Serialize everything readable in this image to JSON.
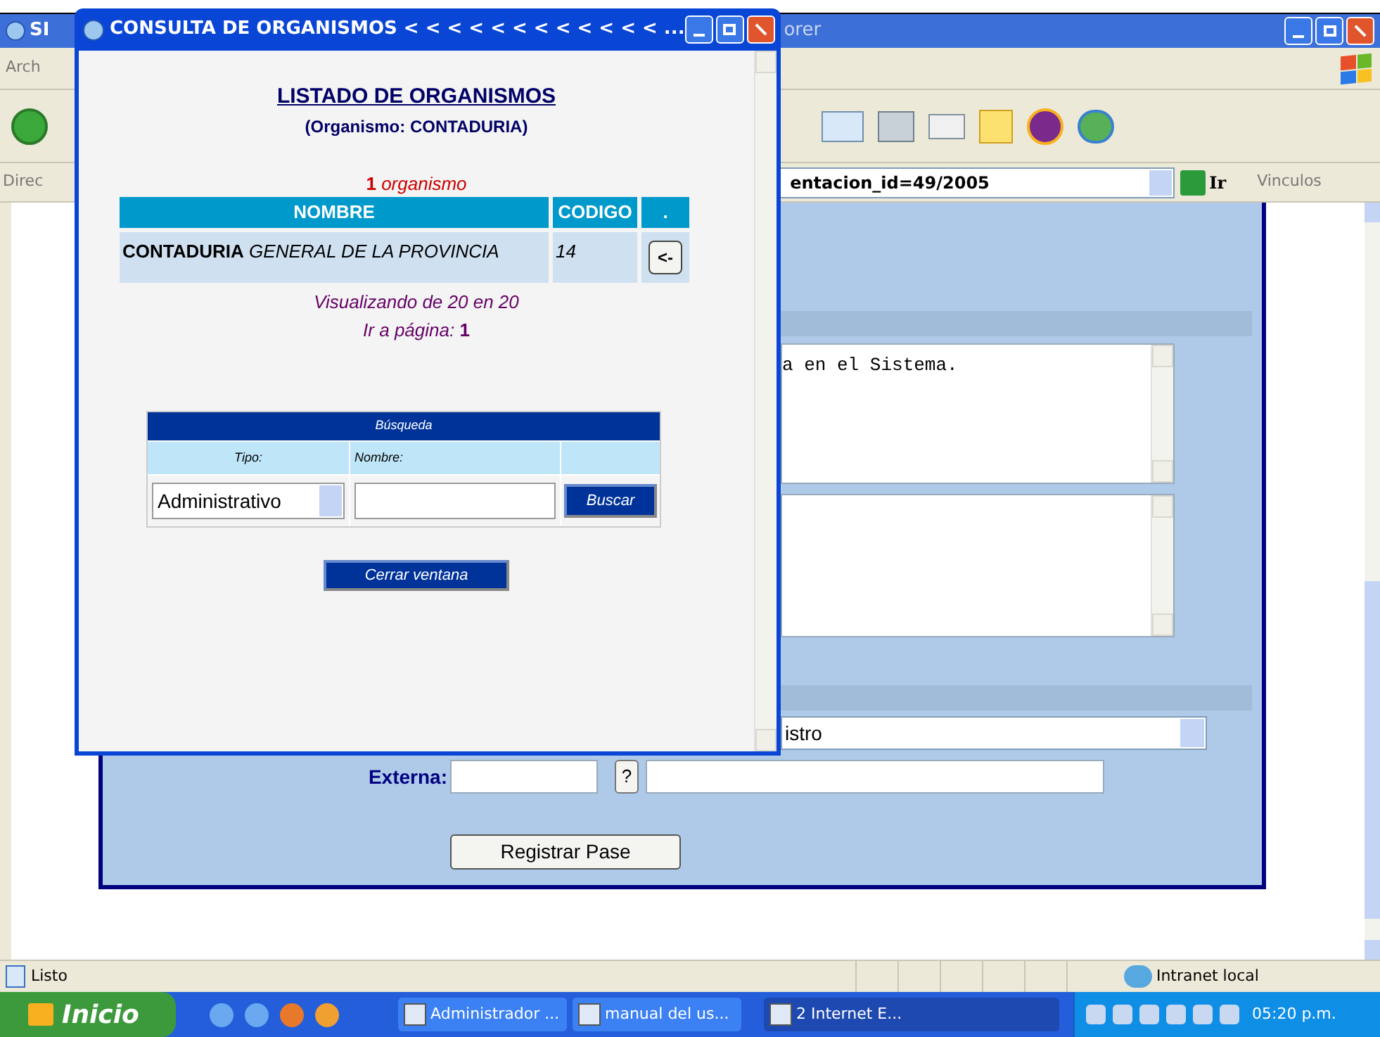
{
  "browser": {
    "title_start": "SI",
    "title_end": "orer",
    "menu": [
      "Arch"
    ],
    "address_label": "Direc",
    "address": "entacion_id=49/2005",
    "go_button": "Ir",
    "links_label": "Vinculos"
  },
  "page": {
    "textarea_text": "a en el Sistema.",
    "select_value": "istro",
    "external_label": "Externa:",
    "help_button": "?",
    "submit_button": "Registrar Pase"
  },
  "status_bar": {
    "text": "Listo",
    "zone": "Intranet local"
  },
  "popup": {
    "title": "CONSULTA DE ORGANISMOS < < < < < < < < < < < < ...",
    "heading": "LISTADO DE ORGANISMOS",
    "subheading": "(Organismo: CONTADURIA)",
    "count": "**1** *organismo*",
    "columns": [
      "NOMBRE",
      "CODIGO",
      "."
    ],
    "rows": [
      {
        "name": "**CONTADURIA** *GENERAL DE LA PROVINCIA*",
        "code": "14",
        "action": "<-"
      }
    ],
    "paging": "Visualizando de 20 en 20",
    "goto": "*Ir a página:* **1**",
    "search": {
      "title": "Búsqueda",
      "type_label": "Tipo:",
      "name_label": "Nombre:",
      "type_value": "Administrativo",
      "button": "Buscar"
    },
    "close_button": "Cerrar ventana"
  },
  "taskbar": {
    "start": "Inicio",
    "tasks": [
      {
        "label": "Administrador ...",
        "selected": false
      },
      {
        "label": "manual del us...",
        "selected": false
      },
      {
        "label": "2 Internet E...",
        "selected": true
      }
    ],
    "clock": "05:20 p.m."
  }
}
